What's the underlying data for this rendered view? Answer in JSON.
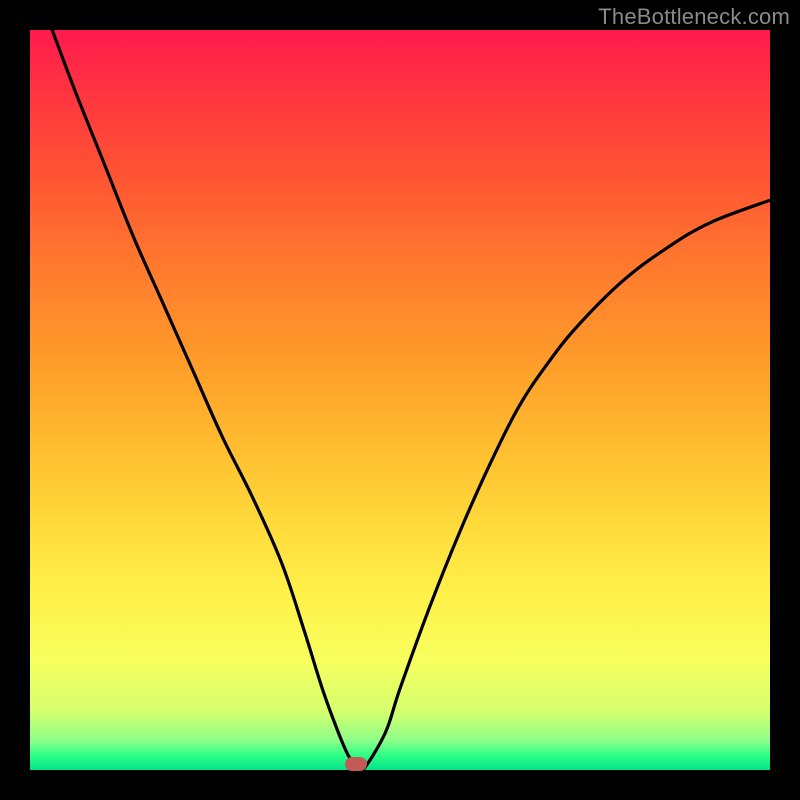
{
  "watermark": "TheBottleneck.com",
  "colors": {
    "curve": "#000000",
    "dot": "#c25a55",
    "frame": "#000000"
  },
  "chart_data": {
    "type": "line",
    "title": "",
    "xlabel": "",
    "ylabel": "",
    "xlim": [
      0,
      100
    ],
    "ylim": [
      0,
      100
    ],
    "note": "Shape read from pixel positions (no axis ticks present). y=100 is top of plot, y=0 is bottom.",
    "series": [
      {
        "name": "bottleneck-curve",
        "x": [
          3,
          6,
          10,
          14,
          18,
          22,
          26,
          30,
          34,
          37,
          39.5,
          41.5,
          43,
          44.3,
          45,
          48,
          50,
          54,
          58,
          62,
          66,
          70,
          74,
          80,
          86,
          92,
          100
        ],
        "y": [
          100,
          92,
          82,
          72,
          63,
          54,
          45,
          37,
          28,
          19,
          11,
          5.5,
          2,
          0.3,
          0,
          5,
          11,
          22,
          32,
          41,
          49,
          55,
          60,
          66,
          70.5,
          74,
          77
        ]
      }
    ],
    "marker": {
      "x": 44.0,
      "y": 0.8
    },
    "background_gradient": {
      "direction": "top-to-bottom",
      "stops": [
        {
          "pct": 0,
          "color": "#ff1a4d"
        },
        {
          "pct": 44,
          "color": "#ff9a2a"
        },
        {
          "pct": 76,
          "color": "#fff048"
        },
        {
          "pct": 100,
          "color": "#00e28a"
        }
      ]
    }
  }
}
